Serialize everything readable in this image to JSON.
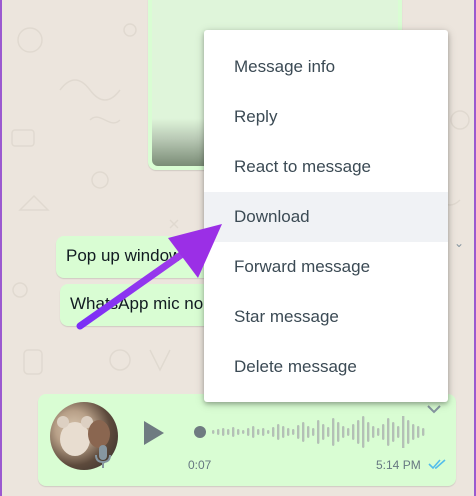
{
  "chat": {
    "messages": [
      {
        "text": "Pop up window"
      },
      {
        "text": "WhatsApp mic no"
      }
    ],
    "voice": {
      "duration": "0:07",
      "time": "5:14 PM"
    }
  },
  "context_menu": {
    "items": [
      {
        "label": "Message info"
      },
      {
        "label": "Reply"
      },
      {
        "label": "React to message"
      },
      {
        "label": "Download"
      },
      {
        "label": "Forward message"
      },
      {
        "label": "Star message"
      },
      {
        "label": "Delete message"
      }
    ],
    "highlighted_index": 3
  },
  "colors": {
    "bubble_out": "#d9fdd3",
    "background": "#ece5dd",
    "menu_hover": "#f0f2f5",
    "annotation_arrow": "#8e2de2",
    "read_ticks": "#53bdeb"
  },
  "icons": {
    "play": "play-icon",
    "mic": "mic-icon",
    "ticks": "double-check-icon",
    "menu_chevron": "chevron-down-icon"
  }
}
